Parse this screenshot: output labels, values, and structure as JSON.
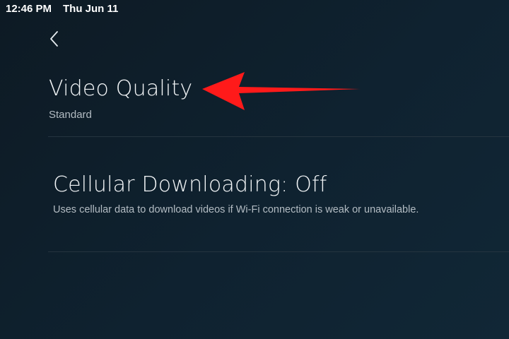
{
  "status_bar": {
    "time": "12:46 PM",
    "date": "Thu Jun 11"
  },
  "navigation": {
    "back_icon": "chevron-left-icon"
  },
  "settings": {
    "video_quality": {
      "title": "Video Quality",
      "value": "Standard"
    },
    "cellular_downloading": {
      "title": "Cellular Downloading: Off",
      "description": "Uses cellular data to download videos if Wi-Fi connection is weak or unavailable."
    }
  },
  "annotation": {
    "arrow_color": "#ff1a1a",
    "arrow_icon": "arrow-left-icon"
  },
  "colors": {
    "background": "#0f2230",
    "text_primary": "#f2f5f7",
    "text_secondary": "#b3bcc3",
    "divider": "#25343f"
  }
}
